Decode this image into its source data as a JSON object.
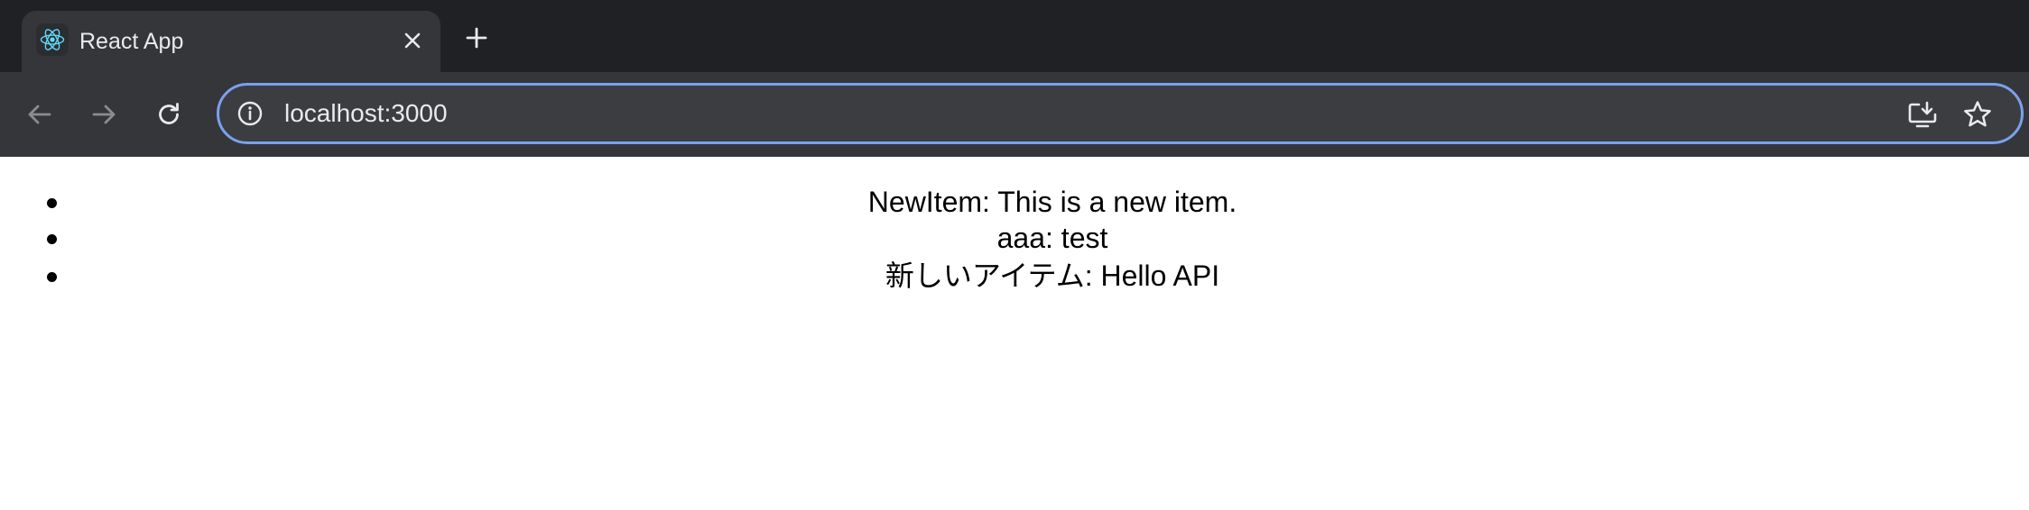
{
  "browser": {
    "tab": {
      "title": "React App",
      "favicon_icon": "react-logo-icon",
      "close_icon": "close-icon"
    },
    "new_tab_icon": "plus-icon",
    "toolbar": {
      "back_icon": "arrow-left-icon",
      "forward_icon": "arrow-right-icon",
      "reload_icon": "reload-icon",
      "info_icon": "info-icon",
      "install_icon": "install-app-icon",
      "bookmark_icon": "star-icon"
    },
    "address": {
      "url": "localhost:3000"
    },
    "colors": {
      "tabstrip_bg": "#202124",
      "toolbar_bg": "#35363a",
      "omnibox_border": "#7ba1ed",
      "react_accent": "#61dafb"
    }
  },
  "page": {
    "items": [
      {
        "name": "NewItem",
        "description": "This is a new item."
      },
      {
        "name": "aaa",
        "description": "test"
      },
      {
        "name": "新しいアイテム",
        "description": "Hello API"
      }
    ]
  }
}
